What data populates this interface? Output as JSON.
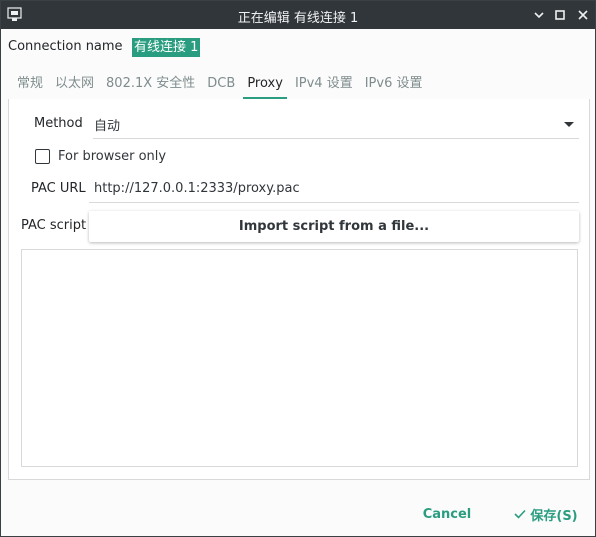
{
  "window": {
    "title": "正在编辑 有线连接 1"
  },
  "connection": {
    "label": "Connection name",
    "value": "有线连接 1"
  },
  "tabs": [
    {
      "label": "常规",
      "active": false
    },
    {
      "label": "以太网",
      "active": false
    },
    {
      "label": "802.1X 安全性",
      "active": false
    },
    {
      "label": "DCB",
      "active": false
    },
    {
      "label": "Proxy",
      "active": true
    },
    {
      "label": "IPv4 设置",
      "active": false
    },
    {
      "label": "IPv6 设置",
      "active": false
    }
  ],
  "proxy": {
    "method_label": "Method",
    "method_value": "自动",
    "browser_only_label": "For browser only",
    "browser_only_checked": false,
    "pac_url_label": "PAC URL",
    "pac_url_value": "http://127.0.0.1:2333/proxy.pac",
    "pac_script_label": "PAC script",
    "import_button_label": "Import script from a file...",
    "script_content": ""
  },
  "footer": {
    "cancel_label": "Cancel",
    "save_label": "保存(S)"
  },
  "colors": {
    "accent": "#2a9d80",
    "titlebar": "#31363b"
  },
  "icons": [
    "network-app-icon",
    "chevron-down-icon",
    "minimize-icon",
    "maximize-icon",
    "close-icon",
    "checkmark-icon"
  ]
}
